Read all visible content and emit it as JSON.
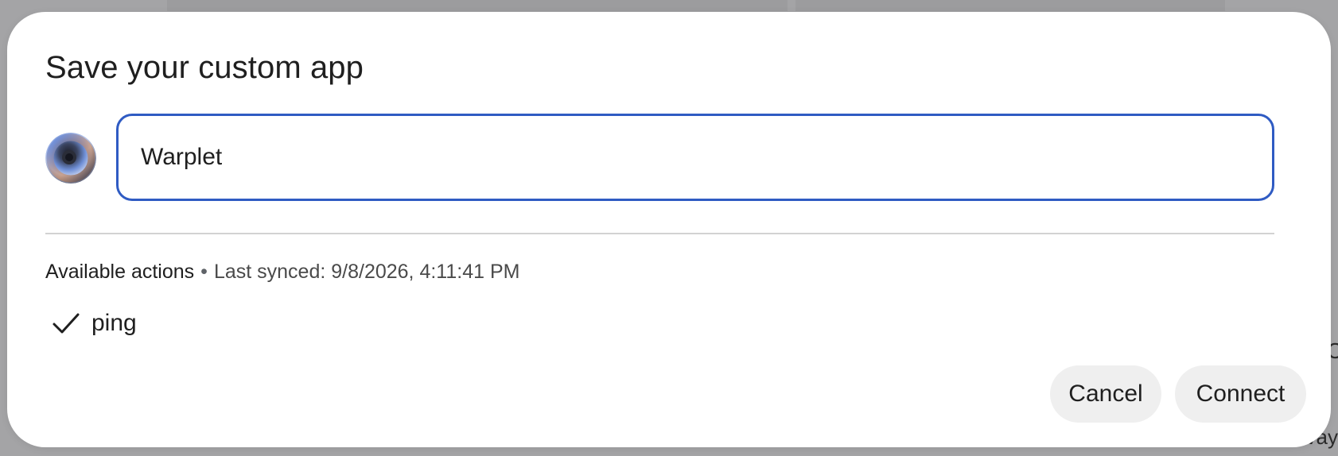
{
  "background": {
    "edge_text_top": "C",
    "edge_text_bottom": "vay"
  },
  "dialog": {
    "title": "Save your custom app",
    "app_icon": "app-logo-icon",
    "name_field": {
      "value": "Warplet"
    },
    "actions_section": {
      "heading": "Available actions",
      "separator": "•",
      "last_synced": "Last synced: 9/8/2026, 4:11:41 PM"
    },
    "actions": [
      {
        "icon": "checkmark-icon",
        "label": "ping"
      }
    ],
    "buttons": {
      "cancel": "Cancel",
      "connect": "Connect"
    }
  },
  "colors": {
    "overlay": "#a4a4a6",
    "focus_border": "#2f5bc3",
    "button_bg": "#efefef",
    "text_primary": "#1f1f1f"
  }
}
